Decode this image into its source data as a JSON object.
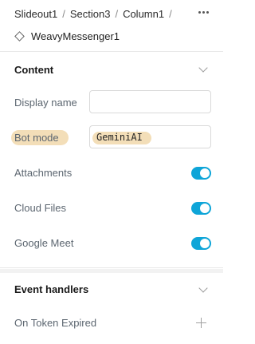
{
  "breadcrumb": {
    "items": [
      "Slideout1",
      "Section3",
      "Column1"
    ],
    "separator": "/"
  },
  "header": {
    "component_name": "WeavyMessenger1",
    "component_icon": "diamond-icon",
    "more_icon": "more-horizontal-icon"
  },
  "content_section": {
    "title": "Content",
    "display_name": {
      "label": "Display name",
      "value": ""
    },
    "bot_mode": {
      "label": "Bot mode",
      "value": "GeminiAI"
    },
    "attachments": {
      "label": "Attachments",
      "enabled": true
    },
    "cloud_files": {
      "label": "Cloud Files",
      "enabled": true
    },
    "google_meet": {
      "label": "Google Meet",
      "enabled": true
    }
  },
  "event_handlers_section": {
    "title": "Event handlers",
    "on_token_expired": {
      "label": "On Token Expired"
    }
  },
  "colors": {
    "toggle_on": "#0ea5d8",
    "highlight": "#f3deb8"
  }
}
